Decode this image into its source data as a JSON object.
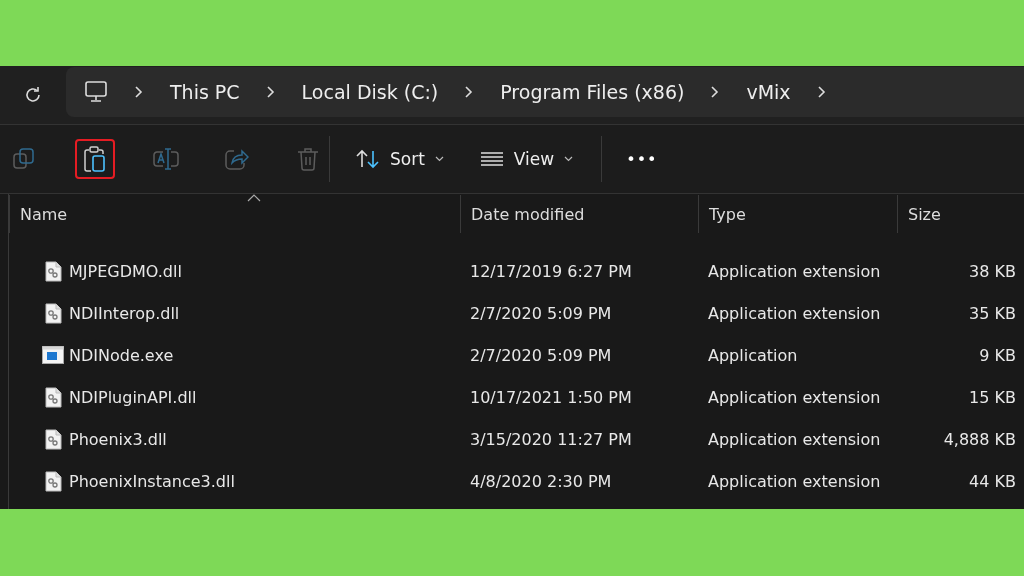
{
  "address_bar": {
    "path": [
      "This PC",
      "Local Disk (C:)",
      "Program Files (x86)",
      "vMix"
    ]
  },
  "toolbar": {
    "actions": [
      {
        "kind": "copy",
        "disabled": true,
        "highlighted": false
      },
      {
        "kind": "paste",
        "disabled": false,
        "highlighted": true
      },
      {
        "kind": "rename",
        "disabled": true,
        "highlighted": false
      },
      {
        "kind": "share",
        "disabled": true,
        "highlighted": false
      },
      {
        "kind": "delete",
        "disabled": true,
        "highlighted": false
      },
      {
        "kind": "sort",
        "label": "Sort"
      },
      {
        "kind": "view",
        "label": "View"
      },
      {
        "kind": "more",
        "label": "•••"
      }
    ]
  },
  "file_list": {
    "columns": [
      "Name",
      "Date modified",
      "Type",
      "Size"
    ],
    "rows": [
      {
        "kind": "dll",
        "name": "MJPEGDMO.dll",
        "date": "12/17/2019 6:27 PM",
        "type": "Application extension",
        "size": "38 KB"
      },
      {
        "kind": "dll",
        "name": "NDIInterop.dll",
        "date": "2/7/2020 5:09 PM",
        "type": "Application extension",
        "size": "35 KB"
      },
      {
        "kind": "exe",
        "name": "NDINode.exe",
        "date": "2/7/2020 5:09 PM",
        "type": "Application",
        "size": "9 KB"
      },
      {
        "kind": "dll",
        "name": "NDIPluginAPI.dll",
        "date": "10/17/2021 1:50 PM",
        "type": "Application extension",
        "size": "15 KB"
      },
      {
        "kind": "dll",
        "name": "Phoenix3.dll",
        "date": "3/15/2020 11:27 PM",
        "type": "Application extension",
        "size": "4,888 KB"
      },
      {
        "kind": "dll",
        "name": "PhoenixInstance3.dll",
        "date": "4/8/2020 2:30 PM",
        "type": "Application extension",
        "size": "44 KB"
      }
    ]
  }
}
